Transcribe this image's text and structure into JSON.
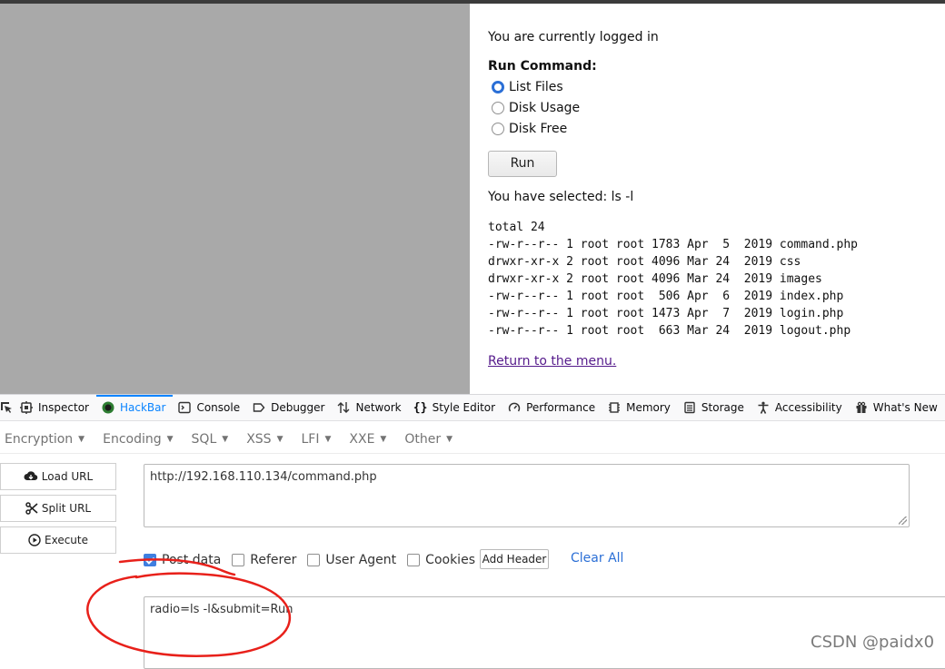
{
  "page": {
    "login_status": "You are currently logged in",
    "run_command_label": "Run Command:",
    "options": [
      {
        "label": "List Files",
        "checked": true
      },
      {
        "label": "Disk Usage",
        "checked": false
      },
      {
        "label": "Disk Free",
        "checked": false
      }
    ],
    "run_button": "Run",
    "selected_text": "You have selected: ls -l",
    "output_lines": [
      "total 24",
      "-rw-r--r-- 1 root root 1783 Apr  5  2019 command.php",
      "drwxr-xr-x 2 root root 4096 Mar 24  2019 css",
      "drwxr-xr-x 2 root root 4096 Mar 24  2019 images",
      "-rw-r--r-- 1 root root  506 Apr  6  2019 index.php",
      "-rw-r--r-- 1 root root 1473 Apr  7  2019 login.php",
      "-rw-r--r-- 1 root root  663 Mar 24  2019 logout.php"
    ],
    "return_link": "Return to the menu."
  },
  "devtools": {
    "tabs": [
      {
        "label": "Inspector",
        "icon": "inspector-icon"
      },
      {
        "label": "HackBar",
        "icon": "hackbar-icon",
        "active": true
      },
      {
        "label": "Console",
        "icon": "console-icon"
      },
      {
        "label": "Debugger",
        "icon": "debugger-icon"
      },
      {
        "label": "Network",
        "icon": "network-icon"
      },
      {
        "label": "Style Editor",
        "icon": "braces-icon"
      },
      {
        "label": "Performance",
        "icon": "gauge-icon"
      },
      {
        "label": "Memory",
        "icon": "memory-icon"
      },
      {
        "label": "Storage",
        "icon": "storage-icon"
      },
      {
        "label": "Accessibility",
        "icon": "accessibility-icon"
      },
      {
        "label": "What's New",
        "icon": "gift-icon"
      }
    ],
    "accent": "#0a84ff"
  },
  "hackbar": {
    "menus": [
      "Encryption",
      "Encoding",
      "SQL",
      "XSS",
      "LFI",
      "XXE",
      "Other"
    ],
    "buttons": {
      "load_url": "Load URL",
      "split_url": "Split URL",
      "execute": "Execute"
    },
    "url": "http://192.168.110.134/command.php",
    "checkboxes": [
      {
        "label": "Post data",
        "checked": true
      },
      {
        "label": "Referer",
        "checked": false
      },
      {
        "label": "User Agent",
        "checked": false
      },
      {
        "label": "Cookies",
        "checked": false
      }
    ],
    "add_header": "Add Header",
    "clear_all": "Clear All",
    "post_data": "radio=ls -l&submit=Run"
  },
  "watermark": "CSDN @paidx0",
  "annotation_color": "#e8201a"
}
